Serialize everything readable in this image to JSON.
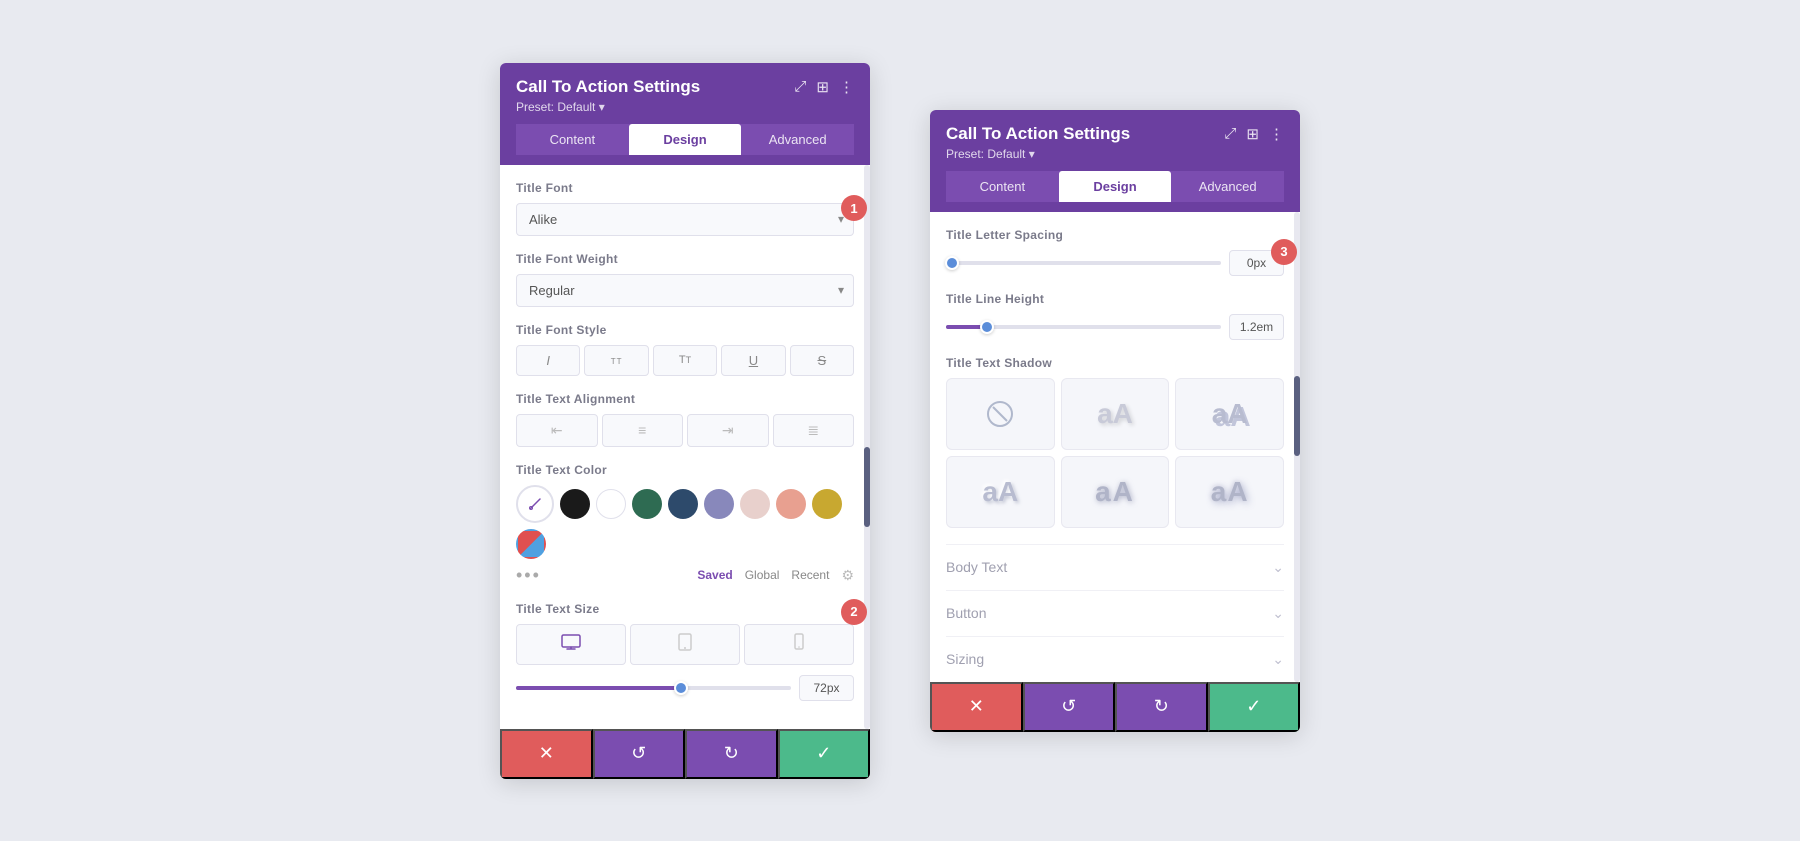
{
  "panel1": {
    "title": "Call To Action Settings",
    "preset": "Preset: Default ▾",
    "tabs": [
      {
        "label": "Content",
        "active": false
      },
      {
        "label": "Design",
        "active": true
      },
      {
        "label": "Advanced",
        "active": false
      }
    ],
    "titleFont": {
      "label": "Title Font",
      "value": "Alike"
    },
    "titleFontWeight": {
      "label": "Title Font Weight",
      "value": "Regular"
    },
    "titleFontStyle": {
      "label": "Title Font Style",
      "buttons": [
        "I",
        "TT",
        "Tr",
        "U",
        "S"
      ]
    },
    "titleTextAlignment": {
      "label": "Title Text Alignment",
      "buttons": [
        "≡",
        "≡",
        "≡",
        "≡"
      ]
    },
    "titleTextColor": {
      "label": "Title Text Color",
      "colors": [
        "#1a1a1a",
        "#ffffff",
        "#2e6b52",
        "#2d4a6b",
        "#7b7bbb",
        "#e8d8d0",
        "#e8a090",
        "#c8a830",
        "#e05050"
      ],
      "tabs": [
        "Saved",
        "Global",
        "Recent"
      ]
    },
    "titleTextSize": {
      "label": "Title Text Size",
      "value": "72px",
      "sliderPercent": 60
    },
    "badge1": "1",
    "badge2": "2"
  },
  "panel2": {
    "title": "Call To Action Settings",
    "preset": "Preset: Default ▾",
    "tabs": [
      {
        "label": "Content",
        "active": false
      },
      {
        "label": "Design",
        "active": true
      },
      {
        "label": "Advanced",
        "active": false
      }
    ],
    "titleLetterSpacing": {
      "label": "Title Letter Spacing",
      "value": "0px",
      "sliderPercent": 2
    },
    "titleLineHeight": {
      "label": "Title Line Height",
      "value": "1.2em",
      "sliderPercent": 15
    },
    "titleTextShadow": {
      "label": "Title Text Shadow"
    },
    "bodyText": {
      "label": "Body Text"
    },
    "button": {
      "label": "Button"
    },
    "sizing": {
      "label": "Sizing"
    },
    "badge3": "3"
  },
  "icons": {
    "close": "✕",
    "undo": "↺",
    "redo": "↻",
    "check": "✓",
    "chevronDown": "⌄",
    "eyedropper": "✏",
    "dots": "•••",
    "gear": "⚙",
    "desktop": "🖥",
    "tablet": "⬜",
    "mobile": "▯",
    "screenResize": "⤢",
    "columns": "⊞",
    "moreVert": "⋮"
  }
}
